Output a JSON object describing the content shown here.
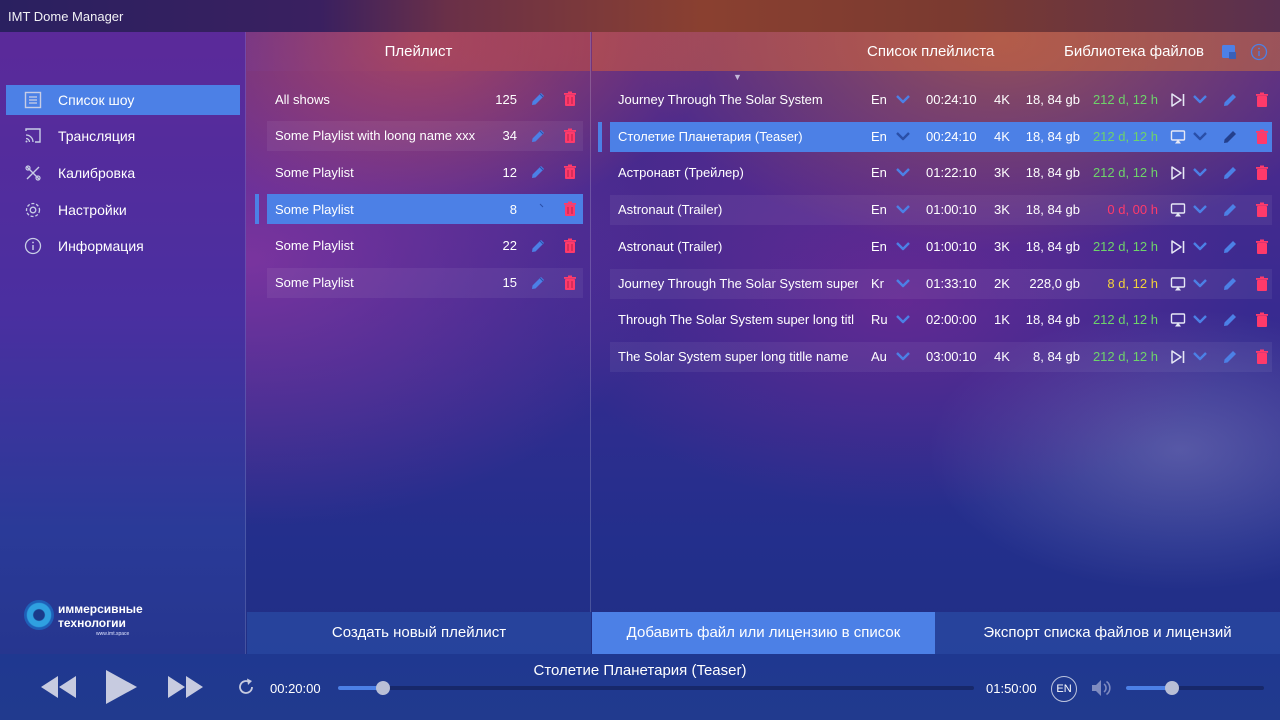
{
  "window": {
    "title": "IMT Dome Manager"
  },
  "sidebar": {
    "items": [
      {
        "label": "Список шоу",
        "icon": "list-icon",
        "active": true
      },
      {
        "label": "Трансляция",
        "icon": "cast-icon",
        "active": false
      },
      {
        "label": "Калибровка",
        "icon": "calibration-icon",
        "active": false
      },
      {
        "label": "Настройки",
        "icon": "gear-icon",
        "active": false
      },
      {
        "label": "Информация",
        "icon": "info-icon",
        "active": false
      }
    ],
    "logo": {
      "line1": "иммерсивные",
      "line2": "технологии",
      "url": "www.imt.space"
    }
  },
  "playlists": {
    "header": "Плейлист",
    "items": [
      {
        "name": "All shows",
        "count": "125"
      },
      {
        "name": "Some Playlist with loong name xxx",
        "count": "34"
      },
      {
        "name": "Some Playlist",
        "count": "12"
      },
      {
        "name": "Some Playlist",
        "count": "8"
      },
      {
        "name": "Some Playlist",
        "count": "22"
      },
      {
        "name": "Some Playlist",
        "count": "15"
      }
    ],
    "selected_index": 3,
    "create_button": "Создать новый плейлист"
  },
  "showlist": {
    "header": "Список плейлиста",
    "library_tab": "Библиотека файлов",
    "rows": [
      {
        "title": "Journey Through The Solar System",
        "lang": "En",
        "duration": "00:24:10",
        "res": "4K",
        "size": "18, 84 gb",
        "license": "212 d, 12 h",
        "license_status": "green",
        "mode": "skip-next-icon"
      },
      {
        "title": "Столетие Планетария (Teaser)",
        "lang": "En",
        "duration": "00:24:10",
        "res": "4K",
        "size": "18, 84 gb",
        "license": "212 d, 12 h",
        "license_status": "green",
        "mode": "loop-screen-icon"
      },
      {
        "title": "Астронавт (Трейлер)",
        "lang": "En",
        "duration": "01:22:10",
        "res": "3K",
        "size": "18, 84 gb",
        "license": "212 d, 12 h",
        "license_status": "green",
        "mode": "skip-next-icon"
      },
      {
        "title": "Astronaut  (Trailer)",
        "lang": "En",
        "duration": "01:00:10",
        "res": "3K",
        "size": "18, 84 gb",
        "license": "0 d, 00 h",
        "license_status": "red",
        "mode": "loop-screen-icon"
      },
      {
        "title": "Astronaut  (Trailer)",
        "lang": "En",
        "duration": "01:00:10",
        "res": "3K",
        "size": "18, 84 gb",
        "license": "212 d, 12 h",
        "license_status": "green",
        "mode": "skip-next-icon"
      },
      {
        "title": "Journey Through The Solar System super",
        "lang": "Kr",
        "duration": "01:33:10",
        "res": "2K",
        "size": "228,0 gb",
        "license": "8 d, 12 h",
        "license_status": "yellow",
        "mode": "loop-screen-icon"
      },
      {
        "title": "Through The Solar System super long titl",
        "lang": "Ru",
        "duration": "02:00:00",
        "res": "1K",
        "size": "18, 84 gb",
        "license": "212 d, 12 h",
        "license_status": "green",
        "mode": "loop-screen-icon"
      },
      {
        "title": "The Solar System super long titlle name",
        "lang": "Au",
        "duration": "03:00:10",
        "res": "4K",
        "size": "8, 84 gb",
        "license": "212 d, 12 h",
        "license_status": "green",
        "mode": "skip-next-icon"
      }
    ],
    "selected_index": 1,
    "add_button": "Добавить файл или лицензию в список",
    "export_button": "Экспорт списка файлов и лицензий"
  },
  "player": {
    "now_playing": "Столетие Планетария (Teaser)",
    "current_time": "00:20:00",
    "total_time": "01:50:00",
    "progress": 0.07,
    "audio_lang": "EN",
    "volume": 0.33
  },
  "colors": {
    "accent": "#4c80e6",
    "edit": "#4c80e6",
    "delete": "#ff3a6a",
    "license_green": "#6ed36a",
    "license_red": "#ff3a6a",
    "license_yellow": "#f3d23a"
  }
}
